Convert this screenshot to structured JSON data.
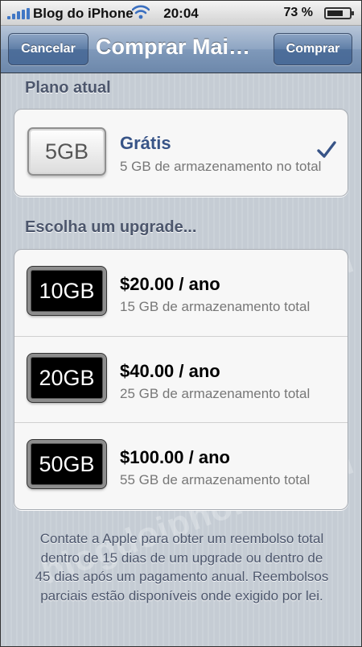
{
  "status_bar": {
    "carrier": "Blog do iPhone",
    "time": "20:04",
    "battery_percent": "73 %",
    "battery_level": 0.73
  },
  "nav_bar": {
    "cancel_label": "Cancelar",
    "title": "Comprar Mais Armazenamento",
    "buy_label": "Comprar"
  },
  "current_plan": {
    "header": "Plano atual",
    "plan": {
      "icon_label": "5GB",
      "title": "Grátis",
      "subtitle": "5 GB de armazenamento no total",
      "selected": true
    }
  },
  "upgrades": {
    "header": "Escolha um upgrade...",
    "items": [
      {
        "icon_label": "10GB",
        "title": "$20.00 / ano",
        "subtitle": "15 GB de armazenamento total"
      },
      {
        "icon_label": "20GB",
        "title": "$40.00 / ano",
        "subtitle": "25 GB de armazenamento total"
      },
      {
        "icon_label": "50GB",
        "title": "$100.00 / ano",
        "subtitle": "55 GB de armazenamento total"
      }
    ]
  },
  "footer_note": "Contate a Apple para obter um reembolso total dentro de 15 dias de um upgrade ou dentro de 45 dias após um pagamento anual. Reembolsos parciais estão disponíveis onde exigido por lei.",
  "watermark": "blogdoiphone.com",
  "colors": {
    "nav_bar": "#6d88ab",
    "section_header": "#4c566c",
    "checkmark": "#385487",
    "background": "#c5ccd4"
  }
}
